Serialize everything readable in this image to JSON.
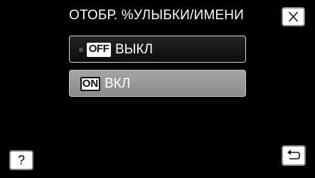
{
  "header": {
    "title": "ОТОБР. %УЛЫБКИ/ИМЕНИ"
  },
  "options": [
    {
      "badge": "OFF",
      "label": "ВЫКЛ",
      "selected": true
    },
    {
      "badge": "ON",
      "label": "ВКЛ",
      "selected": false
    }
  ],
  "controls": {
    "help_label": "?",
    "close_icon": "close-icon",
    "back_icon": "return-arrow-icon"
  },
  "colors": {
    "background": "#000000",
    "option_selected": "#141414",
    "option_unselected": "#999999",
    "button_face": "#ffffff"
  }
}
